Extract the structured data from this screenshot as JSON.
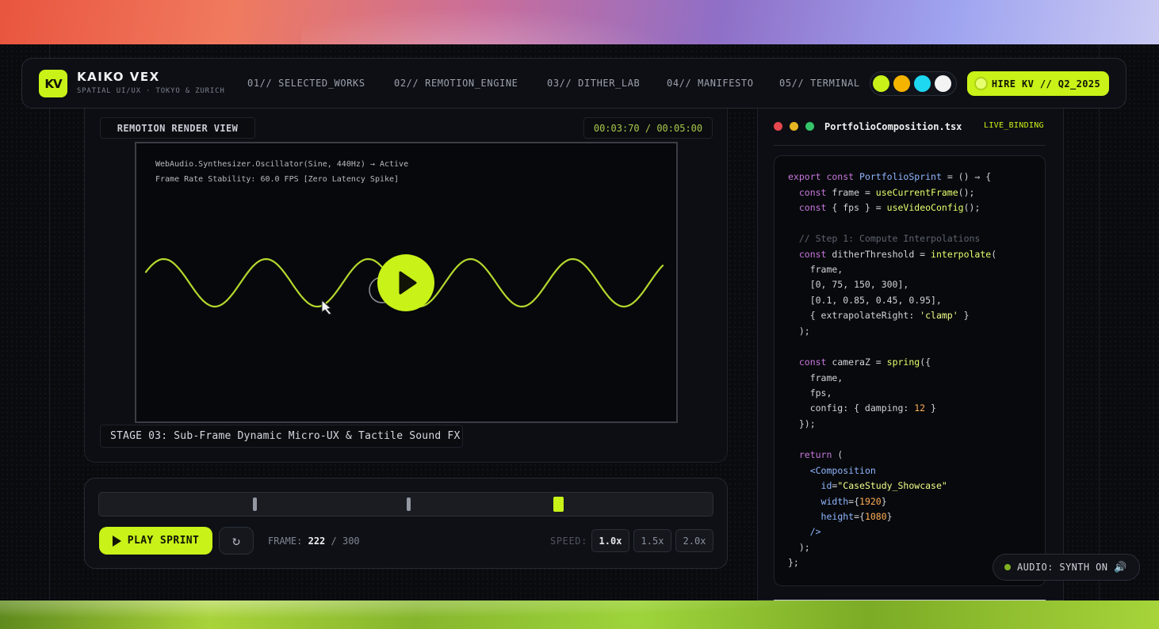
{
  "brand": {
    "logo_text": "KV",
    "name": "KAIKO VEX",
    "tagline": "SPATIAL UI/UX · TOKYO & ZURICH"
  },
  "nav": {
    "items": [
      {
        "label": "01// SELECTED_WORKS"
      },
      {
        "label": "02// REMOTION_ENGINE"
      },
      {
        "label": "03// DITHER_LAB"
      },
      {
        "label": "04// MANIFESTO"
      },
      {
        "label": "05// TERMINAL"
      }
    ],
    "theme_swatches": [
      "#c8f218",
      "#f5b400",
      "#1ed7f0",
      "#f3f3f3"
    ],
    "hire_label": "HIRE KV // Q2_2025"
  },
  "render": {
    "view_label": "REMOTION RENDER VIEW",
    "timecode": "00:03:70 / 00:05:00",
    "debug_lines": [
      "WebAudio.Synthesizer.Oscillator(Sine, 440Hz) → Active",
      "Frame Rate Stability: 60.0 FPS [Zero Latency Spike]"
    ],
    "stage_label": "STAGE 03: Sub-Frame Dynamic Micro-UX & Tactile Sound FX",
    "accent": "#c8f218"
  },
  "controls": {
    "play_label": "PLAY SPRINT",
    "reset_icon": "↻",
    "frame_prefix": "FRAME:",
    "frame_current": "222",
    "frame_total": "/ 300",
    "playhead_fraction": 0.74,
    "speed_label": "SPEED:",
    "speeds": [
      "1.0x",
      "1.5x",
      "2.0x"
    ],
    "active_speed": "1.0x"
  },
  "code": {
    "file_name": "PortfolioComposition.tsx",
    "badge": "LIVE_BINDING",
    "window_dots": [
      "#e5484d",
      "#e6b422",
      "#35c46a"
    ]
  },
  "audio": {
    "label": "AUDIO: SYNTH ON",
    "speaker_icon": "🔊"
  }
}
